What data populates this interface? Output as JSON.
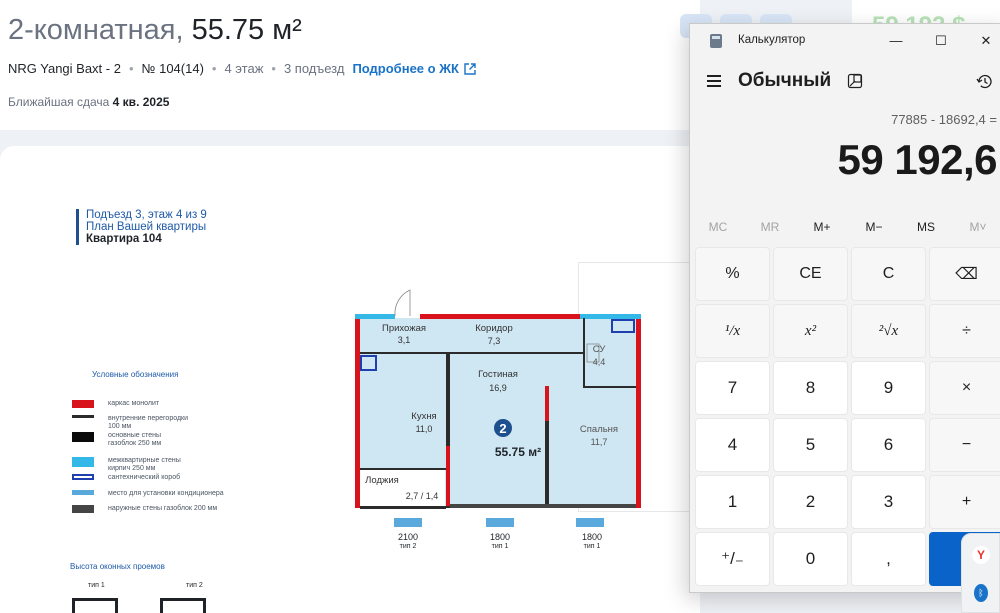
{
  "listing": {
    "title_rooms": "2-комнатная,",
    "title_area": " 55.75 м²",
    "complex": "NRG Yangi Baxt - 2",
    "apt_number": "№ 104(14)",
    "floor": "4 этаж",
    "entrance": "3 подъезд",
    "details_link": "Подробнее о ЖК",
    "delivery_label": "Ближайшая сдача",
    "delivery_value": "4 кв. 2025",
    "price_partial": "59 192 $"
  },
  "plan": {
    "heading_line1": "Подъезд 3, этаж 4 из 9",
    "heading_line2": "План Вашей квартиры",
    "heading_line3": "Квартира 104",
    "rooms": [
      {
        "name": "Прихожая",
        "area": "3,1"
      },
      {
        "name": "Коридор",
        "area": "7,3"
      },
      {
        "name": "СУ",
        "area": "4,4"
      },
      {
        "name": "Кухня",
        "area": "11,0"
      },
      {
        "name": "Гостиная",
        "area": "16,9"
      },
      {
        "name": "Спальня",
        "area": "11,7"
      },
      {
        "name": "Лоджия",
        "area": "2,7 / 1,4"
      }
    ],
    "room_count": "2",
    "total_area": "55.75 м²",
    "windows": [
      {
        "width": "2100",
        "type": "тип 2"
      },
      {
        "width": "1800",
        "type": "тип 1"
      },
      {
        "width": "1800",
        "type": "тип 1"
      }
    ],
    "legend_title": "Условные обозначения",
    "legend": [
      {
        "label": "каркас монолит",
        "color": "#d9131c"
      },
      {
        "label": "внутренние перегородки\n100 мм",
        "color": "#2b2b2b"
      },
      {
        "label": "основные стены\nгазоблок 250 мм",
        "color": "#0a0a0a"
      },
      {
        "label": "межквартирные стены\nкирпич 250 мм",
        "color": "#34b8e8"
      },
      {
        "label": "сантехнический короб",
        "color": "#1f3fae"
      },
      {
        "label": "место для установки кондиционера",
        "color": "#5aa9dc"
      },
      {
        "label": "наружные стены газоблок 200 мм",
        "color": "#454545"
      }
    ],
    "windows_title": "Высота оконных проемов",
    "window_types": [
      "тип 1",
      "тип 2"
    ]
  },
  "calculator": {
    "window_title": "Калькулятор",
    "mode": "Обычный",
    "expression": "77885 - 18692,4 =",
    "result": "59 192,6",
    "memory": [
      "MC",
      "MR",
      "M+",
      "M−",
      "MS",
      "M˅"
    ],
    "keys": [
      [
        "%",
        "CE",
        "C",
        "⌫"
      ],
      [
        "¹/x",
        "x²",
        "²√x",
        "÷"
      ],
      [
        "7",
        "8",
        "9",
        "×"
      ],
      [
        "4",
        "5",
        "6",
        "−"
      ],
      [
        "1",
        "2",
        "3",
        "+"
      ],
      [
        "⁺/₋",
        "0",
        ",",
        "="
      ]
    ],
    "minimize": "—",
    "maximize": "☐",
    "close": "✕"
  },
  "taskbar": {
    "yandex": "Y",
    "bluetooth": "ᛒ"
  }
}
